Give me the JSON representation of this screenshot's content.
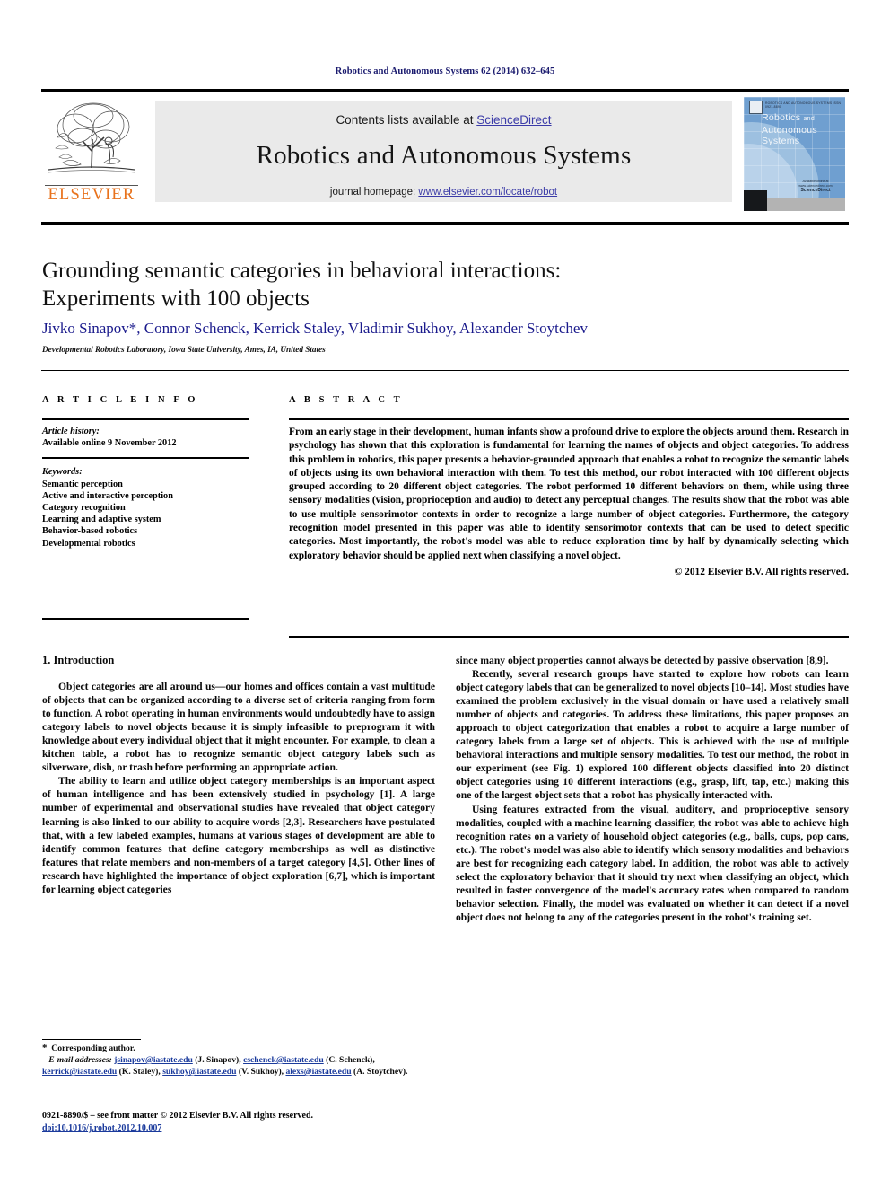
{
  "running_head": "Robotics and Autonomous Systems 62 (2014) 632–645",
  "masthead": {
    "contents_prefix": "Contents lists available at ",
    "sciencedirect": "ScienceDirect",
    "journal_title": "Robotics and Autonomous Systems",
    "homepage_prefix": "journal homepage: ",
    "homepage_url": "www.elsevier.com/locate/robot",
    "publisher_logo_text": "ELSEVIER",
    "accent_orange": "#E8721C",
    "link_blue": "#3b3ba8"
  },
  "cover": {
    "title_line1": "Robotics",
    "title_and": "and",
    "title_line2": "Autonomous Systems",
    "top_microtext": "ROBOTICS AND AUTONOMOUS SYSTEMS     ISSN 0921-8890",
    "center_microtext": "Available online at www.sciencedirect.com",
    "center_brand": "ScienceDirect",
    "bg_color": "#6f9fd0"
  },
  "article": {
    "title_line1": "Grounding semantic categories in behavioral interactions:",
    "title_line2": "Experiments with 100 objects",
    "authors": "Jivko Sinapov*, Connor Schenck, Kerrick Staley, Vladimir Sukhoy, Alexander Stoytchev",
    "affiliation": "Developmental Robotics Laboratory, Iowa State University, Ames, IA, United States",
    "author_color": "#1a1a8c"
  },
  "article_info": {
    "heading": "A R T I C L E   I N F O",
    "history_label": "Article history:",
    "history_value": "Available online 9 November 2012",
    "keywords_label": "Keywords:",
    "keywords": [
      "Semantic perception",
      "Active and interactive perception",
      "Category recognition",
      "Learning and adaptive system",
      "Behavior-based robotics",
      "Developmental robotics"
    ]
  },
  "abstract": {
    "heading": "A B S T R A C T",
    "text": "From an early stage in their development, human infants show a profound drive to explore the objects around them. Research in psychology has shown that this exploration is fundamental for learning the names of objects and object categories. To address this problem in robotics, this paper presents a behavior-grounded approach that enables a robot to recognize the semantic labels of objects using its own behavioral interaction with them. To test this method, our robot interacted with 100 different objects grouped according to 20 different object categories. The robot performed 10 different behaviors on them, while using three sensory modalities (vision, proprioception and audio) to detect any perceptual changes. The results show that the robot was able to use multiple sensorimotor contexts in order to recognize a large number of object categories. Furthermore, the category recognition model presented in this paper was able to identify sensorimotor contexts that can be used to detect specific categories. Most importantly, the robot's model was able to reduce exploration time by half by dynamically selecting which exploratory behavior should be applied next when classifying a novel object.",
    "copyright": "© 2012 Elsevier B.V. All rights reserved."
  },
  "body": {
    "section_heading": "1. Introduction",
    "left_paragraphs": [
      "Object categories are all around us—our homes and offices contain a vast multitude of objects that can be organized according to a diverse set of criteria ranging from form to function. A robot operating in human environments would undoubtedly have to assign category labels to novel objects because it is simply infeasible to preprogram it with knowledge about every individual object that it might encounter. For example, to clean a kitchen table, a robot has to recognize semantic object category labels such as silverware, dish, or trash before performing an appropriate action.",
      "The ability to learn and utilize object category memberships is an important aspect of human intelligence and has been extensively studied in psychology [1]. A large number of experimental and observational studies have revealed that object category learning is also linked to our ability to acquire words [2,3]. Researchers have postulated that, with a few labeled examples, humans at various stages of development are able to identify common features that define category memberships as well as distinctive features that relate members and non-members of a target category [4,5]. Other lines of research have highlighted the importance of object exploration [6,7], which is important for learning object categories"
    ],
    "right_paragraphs": [
      "since many object properties cannot always be detected by passive observation [8,9].",
      "Recently, several research groups have started to explore how robots can learn object category labels that can be generalized to novel objects [10–14]. Most studies have examined the problem exclusively in the visual domain or have used a relatively small number of objects and categories. To address these limitations, this paper proposes an approach to object categorization that enables a robot to acquire a large number of category labels from a large set of objects. This is achieved with the use of multiple behavioral interactions and multiple sensory modalities. To test our method, the robot in our experiment (see Fig. 1) explored 100 different objects classified into 20 distinct object categories using 10 different interactions (e.g., grasp, lift, tap, etc.) making this one of the largest object sets that a robot has physically interacted with.",
      "Using features extracted from the visual, auditory, and proprioceptive sensory modalities, coupled with a machine learning classifier, the robot was able to achieve high recognition rates on a variety of household object categories (e.g., balls, cups, pop cans, etc.). The robot's model was also able to identify which sensory modalities and behaviors are best for recognizing each category label. In addition, the robot was able to actively select the exploratory behavior that it should try next when classifying an object, which resulted in faster convergence of the model's accuracy rates when compared to random behavior selection. Finally, the model was evaluated on whether it can detect if a novel object does not belong to any of the categories present in the robot's training set."
    ],
    "reference_color": "#1a3a9c"
  },
  "footnote": {
    "corresponding": "Corresponding author.",
    "email_label": "E-mail addresses:",
    "emails": [
      {
        "address": "jsinapov@iastate.edu",
        "person": "(J. Sinapov),"
      },
      {
        "address": "cschenck@iastate.edu",
        "person": "(C. Schenck),"
      },
      {
        "address": "kerrick@iastate.edu",
        "person": "(K. Staley),"
      },
      {
        "address": "sukhoy@iastate.edu",
        "person": "(V. Sukhoy),"
      },
      {
        "address": "alexs@iastate.edu",
        "person": "(A. Stoytchev)."
      }
    ],
    "issn_line": "0921-8890/$ – see front matter © 2012 Elsevier B.V. All rights reserved.",
    "doi_line": "doi:10.1016/j.robot.2012.10.007"
  }
}
